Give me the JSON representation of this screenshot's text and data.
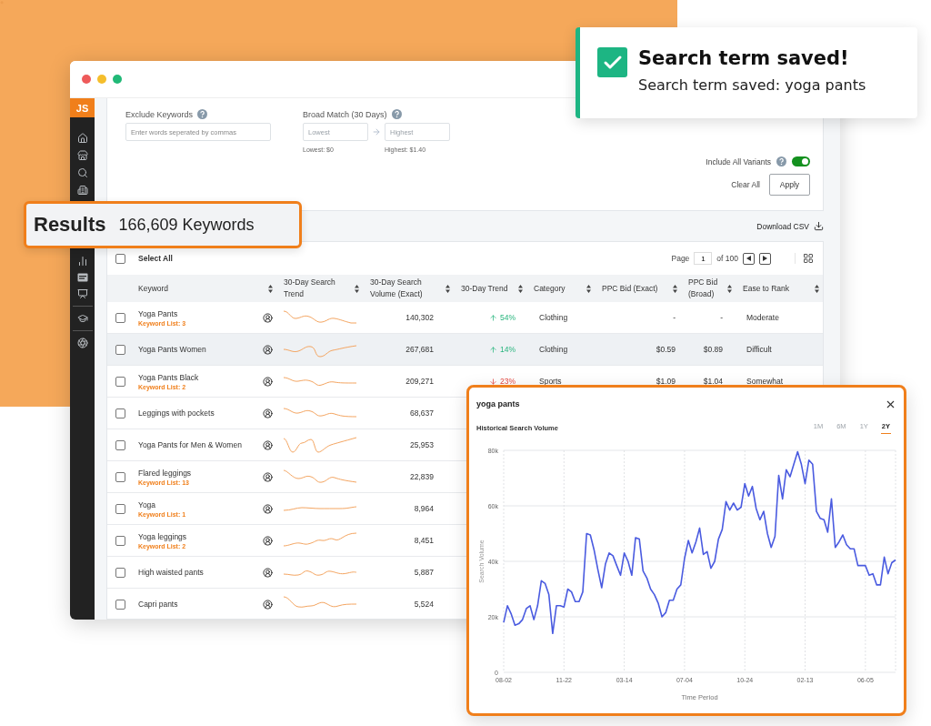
{
  "sidebar": {
    "logo": "JS"
  },
  "filters": {
    "exclude": {
      "label": "Exclude Keywords",
      "placeholder": "Enter words seperated by commas"
    },
    "broad_match": {
      "label": "Broad Match (30 Days)",
      "low": {
        "placeholder": "Lowest",
        "hint": "Lowest: $0"
      },
      "high": {
        "placeholder": "Highest",
        "hint": "Highest: $1.40"
      }
    },
    "include_variants": {
      "label": "Include All Variants",
      "on": true
    },
    "clear": "Clear All",
    "apply": "Apply"
  },
  "results": {
    "title": "Results",
    "count": "166,609 Keywords",
    "download": "Download CSV"
  },
  "table": {
    "select_all": {
      "label": "Select All",
      "checked": false
    },
    "pagination": {
      "label": "Page",
      "page": "1",
      "of": "of 100"
    },
    "columns": [
      "Keyword",
      "30-Day Search Trend",
      "30-Day Search Volume (Exact)",
      "30-Day Trend",
      "Category",
      "PPC Bid (Exact)",
      "PPC Bid (Broad)",
      "Ease to Rank"
    ],
    "rows": [
      {
        "keyword": "Yoga Pants",
        "list": "Keyword List: 3",
        "checked": false,
        "highlighted": false,
        "volume": "140,302",
        "trend": {
          "value": "54%",
          "rising": true
        },
        "category": "Clothing",
        "ppc_exact": "-",
        "ppc_broad": "-",
        "ease": "Moderate"
      },
      {
        "keyword": "Yoga Pants Women",
        "checked": false,
        "highlighted": true,
        "volume": "267,681",
        "trend": {
          "value": "14%",
          "rising": true
        },
        "category": "Clothing",
        "ppc_exact": "$0.59",
        "ppc_broad": "$0.89",
        "ease": "Difficult"
      },
      {
        "keyword": "Yoga Pants Black",
        "list": "Keyword List: 2",
        "checked": false,
        "highlighted": false,
        "volume": "209,271",
        "trend": {
          "value": "23%",
          "rising": false
        },
        "category": "Sports",
        "ppc_exact": "$1.09",
        "ppc_broad": "$1.04",
        "ease": "Somewhat"
      },
      {
        "keyword": "Leggings with pockets",
        "checked": false,
        "highlighted": false,
        "volume": "68,637"
      },
      {
        "keyword": "Yoga Pants for Men & Women",
        "checked": false,
        "highlighted": false,
        "volume": "25,953"
      },
      {
        "keyword": "Flared leggings",
        "list": "Keyword List: 13",
        "checked": false,
        "highlighted": false,
        "volume": "22,839"
      },
      {
        "keyword": "Yoga",
        "list": "Keyword List: 1",
        "checked": false,
        "highlighted": false,
        "volume": "8,964"
      },
      {
        "keyword": "Yoga leggings",
        "list": "Keyword List: 2",
        "checked": false,
        "highlighted": false,
        "volume": "8,451"
      },
      {
        "keyword": "High waisted pants",
        "checked": false,
        "highlighted": false,
        "volume": "5,887"
      },
      {
        "keyword": "Capri pants",
        "checked": false,
        "highlighted": false,
        "volume": "5,524"
      }
    ]
  },
  "chart_popup": {
    "title": "yoga pants",
    "subtitle": "Historical Search Volume",
    "ranges": [
      {
        "label": "1M",
        "selected": false
      },
      {
        "label": "6M",
        "selected": false
      },
      {
        "label": "1Y",
        "selected": false
      },
      {
        "label": "2Y",
        "selected": true
      }
    ],
    "chart_data": {
      "type": "line",
      "xlabel": "Time Period",
      "ylabel": "Search Volume",
      "grid": true,
      "ylim": [
        0,
        80000
      ],
      "categories": [
        "08-02",
        null,
        null,
        null,
        null,
        null,
        null,
        null,
        null,
        null,
        null,
        null,
        null,
        null,
        null,
        null,
        "11-22",
        null,
        null,
        null,
        null,
        null,
        null,
        null,
        null,
        null,
        null,
        null,
        null,
        null,
        null,
        null,
        "03-14",
        null,
        null,
        null,
        null,
        null,
        null,
        null,
        null,
        null,
        null,
        null,
        null,
        null,
        null,
        null,
        "07-04",
        null,
        null,
        null,
        null,
        null,
        null,
        null,
        null,
        null,
        null,
        null,
        null,
        null,
        null,
        null,
        "10-24",
        null,
        null,
        null,
        null,
        null,
        null,
        null,
        null,
        null,
        null,
        null,
        null,
        null,
        null,
        null,
        "02-13",
        null,
        null,
        null,
        null,
        null,
        null,
        null,
        null,
        null,
        null,
        null,
        null,
        null,
        null,
        null,
        "06-05",
        null,
        null,
        null,
        null,
        null,
        null,
        null,
        null
      ],
      "yticks": [
        {
          "value": 0,
          "label": "0"
        },
        {
          "value": 20000,
          "label": "20k"
        },
        {
          "value": 40000,
          "label": "40k"
        },
        {
          "value": 60000,
          "label": "60k"
        },
        {
          "value": 80000,
          "label": "80k"
        }
      ],
      "series": [
        {
          "color": "#4a5be0",
          "values": [
            18000,
            24000,
            21000,
            17000,
            17500,
            19000,
            23000,
            24000,
            19000,
            24000,
            33000,
            32000,
            28000,
            14000,
            24000,
            24000,
            23500,
            30000,
            29000,
            25500,
            25500,
            29000,
            50000,
            49500,
            44000,
            37000,
            30500,
            39000,
            43000,
            42000,
            38500,
            35000,
            43000,
            40000,
            35000,
            48500,
            48000,
            36500,
            34000,
            30000,
            28000,
            25000,
            20000,
            21500,
            26000,
            26000,
            30000,
            31500,
            41000,
            47500,
            43000,
            47000,
            52000,
            42500,
            43500,
            37500,
            40000,
            48000,
            51500,
            61500,
            58500,
            61000,
            58500,
            59500,
            68000,
            63500,
            67000,
            59000,
            55000,
            58000,
            50000,
            45000,
            49000,
            71000,
            62500,
            73000,
            70500,
            75000,
            79500,
            75000,
            68000,
            76500,
            75000,
            58000,
            55500,
            55000,
            50500,
            62500,
            45000,
            47000,
            49500,
            46000,
            44500,
            44500,
            38500,
            38500,
            38500,
            35000,
            35500,
            31500,
            31500,
            41500,
            35500,
            39500,
            40500
          ]
        }
      ]
    }
  },
  "toast": {
    "title": "Search term saved!",
    "message": "Search term saved: yoga pants"
  }
}
